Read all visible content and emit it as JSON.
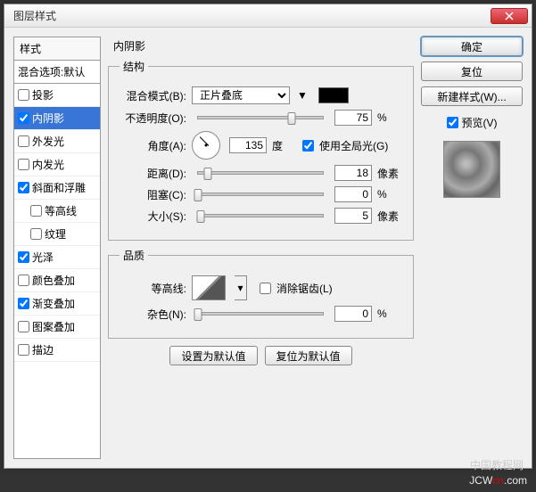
{
  "dialog": {
    "title": "图层样式"
  },
  "styles": {
    "header": "样式",
    "blend": "混合选项:默认",
    "items": [
      {
        "label": "投影",
        "checked": false
      },
      {
        "label": "内阴影",
        "checked": true,
        "selected": true
      },
      {
        "label": "外发光",
        "checked": false
      },
      {
        "label": "内发光",
        "checked": false
      },
      {
        "label": "斜面和浮雕",
        "checked": true
      },
      {
        "label": "等高线",
        "checked": false,
        "indent": true
      },
      {
        "label": "纹理",
        "checked": false,
        "indent": true
      },
      {
        "label": "光泽",
        "checked": true
      },
      {
        "label": "颜色叠加",
        "checked": false
      },
      {
        "label": "渐变叠加",
        "checked": true
      },
      {
        "label": "图案叠加",
        "checked": false
      },
      {
        "label": "描边",
        "checked": false
      }
    ]
  },
  "main": {
    "section_title": "内阴影",
    "structure": {
      "legend": "结构",
      "blend_mode_label": "混合模式(B):",
      "blend_mode_value": "正片叠底",
      "opacity_label": "不透明度(O):",
      "opacity_value": "75",
      "opacity_unit": "%",
      "angle_label": "角度(A):",
      "angle_value": "135",
      "angle_unit": "度",
      "global_light_label": "使用全局光(G)",
      "distance_label": "距离(D):",
      "distance_value": "18",
      "distance_unit": "像素",
      "choke_label": "阻塞(C):",
      "choke_value": "0",
      "choke_unit": "%",
      "size_label": "大小(S):",
      "size_value": "5",
      "size_unit": "像素"
    },
    "quality": {
      "legend": "品质",
      "contour_label": "等高线:",
      "antialias_label": "消除锯齿(L)",
      "noise_label": "杂色(N):",
      "noise_value": "0",
      "noise_unit": "%"
    },
    "defaults_btn": "设置为默认值",
    "reset_btn": "复位为默认值"
  },
  "right": {
    "ok": "确定",
    "cancel": "复位",
    "new_style": "新建样式(W)...",
    "preview_label": "预览(V)"
  },
  "watermark": {
    "cn": "中国教程网",
    "url_pre": "JCW",
    "url_mid": "cn",
    "url_post": ".com"
  }
}
